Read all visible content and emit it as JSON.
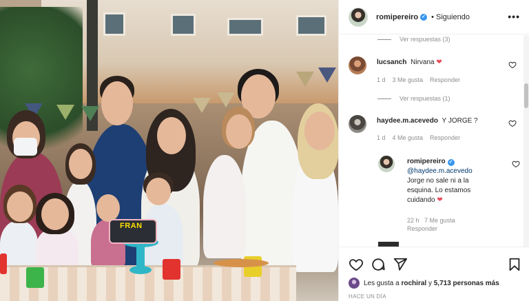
{
  "header": {
    "username": "romipereiro",
    "separator": "•",
    "follow_status": "Siguiendo",
    "more_label": "•••"
  },
  "comments": [
    {
      "view_replies": "Ver respuestas (3)"
    },
    {
      "username": "lucsanch",
      "text": "Nirvana",
      "emoji": "❤",
      "time": "1 d",
      "likes": "3 Me gusta",
      "reply": "Responder",
      "view_replies": "Ver respuestas (1)"
    },
    {
      "username": "haydee.m.acevedo",
      "text": "Y JORGE ?",
      "time": "1 d",
      "likes": "4 Me gusta",
      "reply": "Responder"
    }
  ],
  "reply": {
    "username": "romipereiro",
    "mention": "@haydee.m.acevedo",
    "text": "Jorge no sale ni a la esquina. Lo estamos cuidando",
    "emoji": "❤",
    "time": "22 h",
    "likes": "7 Me gusta",
    "reply": "Responder"
  },
  "photo": {
    "cake_text": "FRAN"
  },
  "likes": {
    "prefix": "Les gusta a",
    "user": "rochiral",
    "middle": "y",
    "count": "5,713 personas más"
  },
  "timestamp": "HACE UN DÍA",
  "colors": {
    "accent_blue": "#3897f0",
    "heart_red": "#ed4956",
    "meta_gray": "#8e8e8e"
  },
  "icons": [
    "verified-badge-icon",
    "heart-icon",
    "comment-icon",
    "share-icon",
    "bookmark-icon",
    "more-icon"
  ]
}
